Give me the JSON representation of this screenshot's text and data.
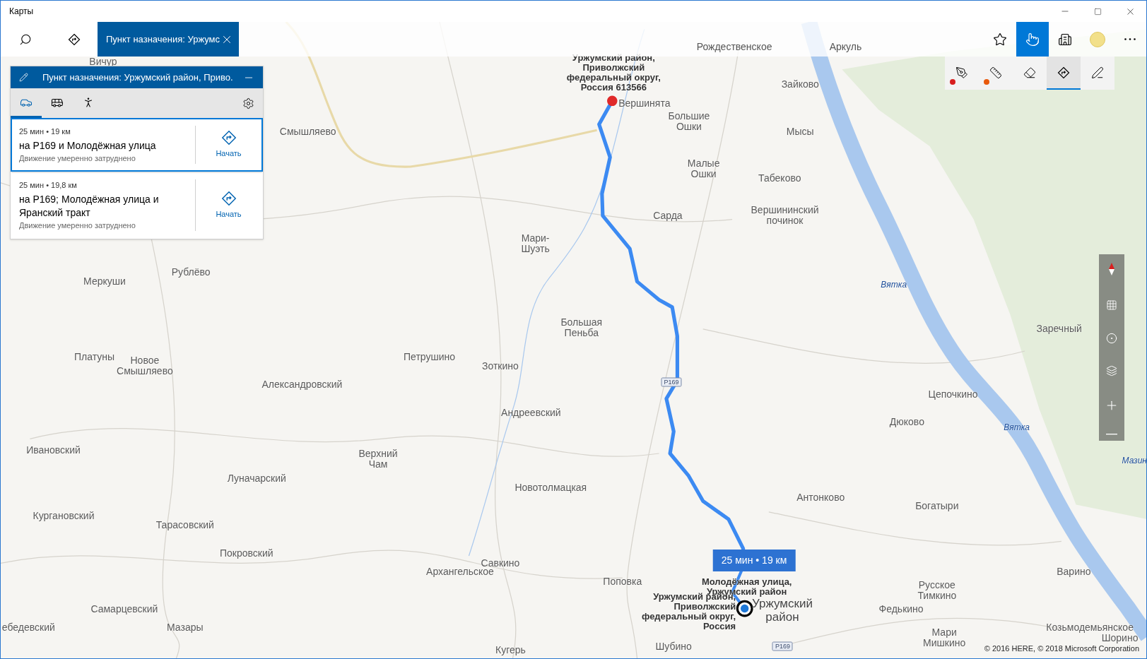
{
  "window": {
    "title": "Карты"
  },
  "top_bar": {
    "tab": {
      "label": "Пункт назначения: Уржумс",
      "selected": true
    },
    "tools": [
      {
        "kind": "favorite",
        "selected": false
      },
      {
        "kind": "touch",
        "selected": true
      },
      {
        "kind": "perspective",
        "selected": false
      }
    ]
  },
  "ink_toolbar": [
    {
      "kind": "ballpoint",
      "selected": false,
      "color": "#d81e1e"
    },
    {
      "kind": "ruler",
      "selected": false,
      "color": "#e8590c"
    },
    {
      "kind": "eraser",
      "selected": false
    },
    {
      "kind": "directions",
      "selected": true
    },
    {
      "kind": "handwriting",
      "selected": false
    }
  ],
  "directions_panel": {
    "title": "Пункт назначения: Уржумский район, Приво.",
    "modes": [
      {
        "kind": "car",
        "selected": true
      },
      {
        "kind": "bus",
        "selected": false
      },
      {
        "kind": "walk",
        "selected": false
      }
    ],
    "routes": [
      {
        "summary": "25 мин • 19 км",
        "via": "на Р169 и Молодёжная улица",
        "traffic": "Движение умеренно затруднено",
        "action": "Начать",
        "selected": true
      },
      {
        "summary": "25 мин • 19,8 км",
        "via": "на Р169; Молодёжная улица и Яранский тракт",
        "traffic": "Движение умеренно затруднено",
        "action": "Начать",
        "selected": false
      }
    ]
  },
  "map": {
    "places": [
      "Вичур",
      "Рождественское",
      "Аркуль",
      "Зайково",
      "Смышляево",
      "Вершинята",
      "Большие Ошки",
      "Мысы",
      "Малые Ошки",
      "Табеково",
      "Сарда",
      "Вершининский починок",
      "Мари-Шуэть",
      "Рублёво",
      "Меркуши",
      "Большая Пеньба",
      "Заречный",
      "Платуны",
      "Новое Смышляево",
      "Петрушино",
      "Зоткино",
      "Александровский",
      "Цепочкино",
      "Андреевский",
      "Дюково",
      "Ивановский",
      "Верхний Чам",
      "Луначарский",
      "Новотолмацкая",
      "Антонково",
      "Богатыри",
      "Кургановский",
      "Тарасовский",
      "Покровский",
      "Савкино",
      "Архангельское",
      "Поповка",
      "Варино",
      "Русское Тимкино",
      "Самарцевский",
      "Федькино",
      "ебедевский",
      "Мазары",
      "Козьмодемьянское",
      "Шорино",
      "Кугерь",
      "Шубино",
      "Мари Мишкино"
    ],
    "river_labels": [
      "Вятка",
      "Вятка",
      "Мазин"
    ],
    "destination_label": "Уржумский район, Приволжский федеральный округ, Россия 613566",
    "origin_labels": [
      "Молодёжная улица, Уржумский район",
      "Уржумский район, Приволжский федеральный округ, Россия"
    ],
    "district_label": "Уржумский район",
    "road_badges": [
      "Р169",
      "Р169"
    ],
    "route_callout": "25 мин • 19 км",
    "attribution": "© 2016 HERE, © 2018 Microsoft Corporation"
  }
}
